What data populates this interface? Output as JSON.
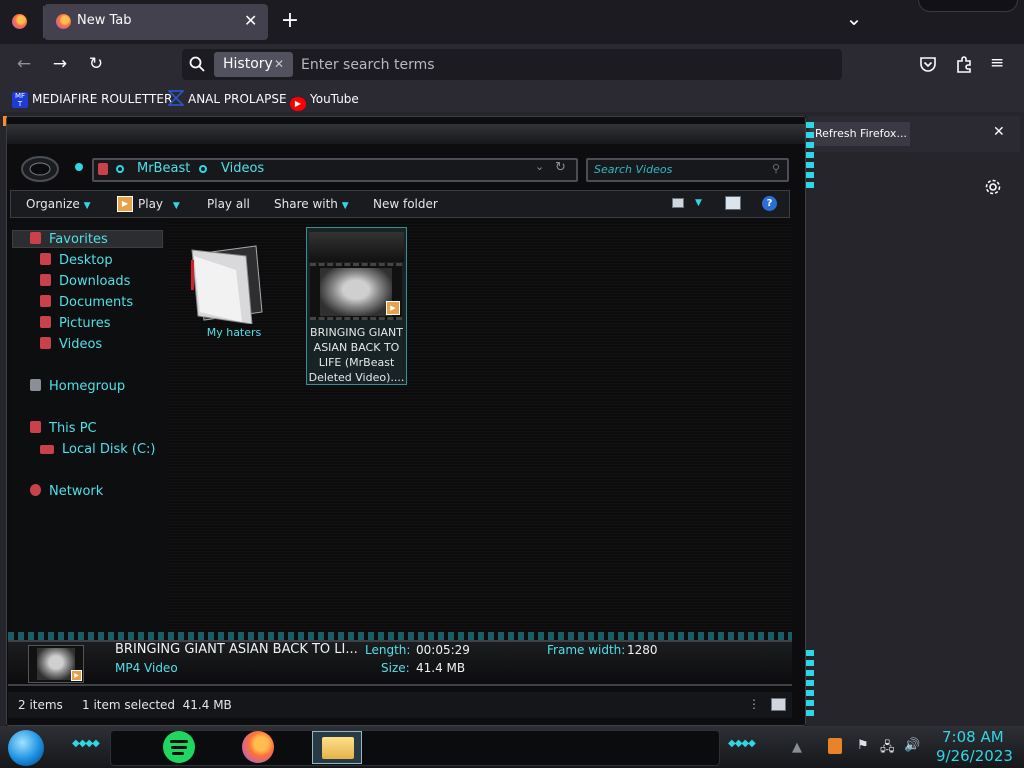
{
  "browser": {
    "tab_title": "New Tab",
    "new_tab_symbol": "+",
    "list_all_tabs_symbol": "⌄",
    "history_chip": "History",
    "search_placeholder": "Enter search terms",
    "bookmarks": [
      {
        "label": "MEDIAFIRE ROULETTER",
        "icon": "mediafire-icon",
        "color": "#1e3ad7"
      },
      {
        "label": "ANAL PROLAPSE",
        "icon": "bookmark-chevron-icon",
        "color": "#2a5bd7"
      },
      {
        "label": "YouTube",
        "icon": "youtube-icon",
        "color": "#ff0000"
      }
    ],
    "notification_button": "Refresh Firefox..."
  },
  "explorer": {
    "breadcrumb": [
      "MrBeast",
      "Videos"
    ],
    "search_placeholder": "Search Videos",
    "commands": [
      "Organize",
      "Play",
      "Play all",
      "Share with",
      "New folder"
    ],
    "nav": {
      "favorites": "Favorites",
      "favorites_items": [
        "Desktop",
        "Downloads",
        "Documents",
        "Pictures",
        "Videos"
      ],
      "homegroup": "Homegroup",
      "this_pc": "This PC",
      "local_disk": "Local Disk (C:)",
      "network": "Network"
    },
    "items": [
      {
        "name": "My haters",
        "type": "folder"
      },
      {
        "name": "BRINGING GIANT ASIAN BACK TO LIFE (MrBeast Deleted Video)....",
        "type": "video",
        "selected": true
      }
    ],
    "details": {
      "title": "BRINGING GIANT ASIAN BACK TO LI...",
      "filetype": "MP4 Video",
      "length_label": "Length:",
      "length_value": "00:05:29",
      "size_label": "Size:",
      "size_value": "41.4 MB",
      "frame_width_label": "Frame width:",
      "frame_width_value": "1280"
    },
    "status": {
      "items_count": "2 items",
      "selection": "1 item selected  41.4 MB"
    }
  },
  "taskbar": {
    "time": "7:08 AM",
    "date": "9/26/2023"
  },
  "colors": {
    "accent_cyan": "#2fd7e6",
    "link_cyan": "#4fe0e8",
    "firefox_dark": "#1c1b22",
    "firefox_toolbar": "#2b2a33"
  }
}
